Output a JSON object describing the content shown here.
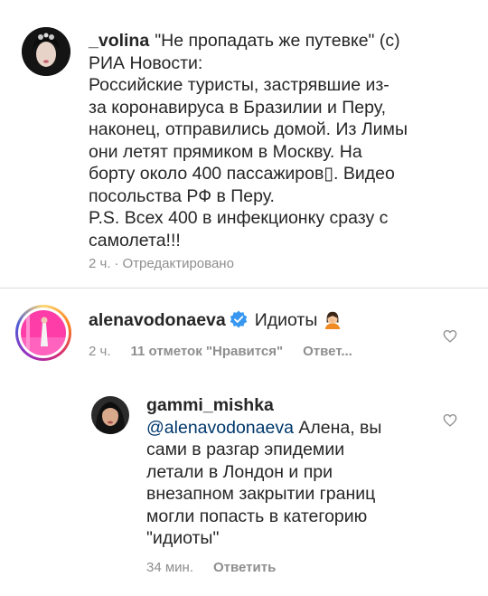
{
  "comments": [
    {
      "username": "_volina",
      "body_first": "\"Не пропадать же путевке\" (с)",
      "body_lines": [
        "РИА Новости:",
        "Российские туристы, застрявшие из-",
        "за коронавируса в Бразилии и Перу,",
        "наконец, отправились домой. Из Лимы",
        "они летят прямиком в Москву. На",
        "борту около 400 пассажиров▯. Видео",
        "посольства РФ в Перу.",
        "P.S. Всех 400 в инфекционку сразу с",
        "самолета!!!"
      ],
      "time": "2 ч.",
      "edited": "Отредактировано",
      "separator": "·"
    },
    {
      "username": "alenavodonaeva",
      "body": "Идиоты",
      "time": "2 ч.",
      "likes": "11 отметок \"Нравится\"",
      "reply": "Ответ..."
    },
    {
      "username": "gammi_mishka",
      "mention": "@alenavodonaeva",
      "body_first": "Алена, вы",
      "body_lines": [
        "сами в разгар эпидемии",
        "летали в Лондон и при",
        "внезапном закрытии границ",
        "могли попасть в категорию",
        "\"идиоты\""
      ],
      "time": "34 мин.",
      "reply": "Ответить"
    }
  ],
  "icons": {
    "heart": "heart-outline-icon",
    "verified": "verified-badge-icon",
    "emoji": "facepalm-emoji-icon"
  },
  "colors": {
    "text": "#262626",
    "muted": "#8e8e8e",
    "mention": "#00376b",
    "verified": "#3897f0"
  }
}
